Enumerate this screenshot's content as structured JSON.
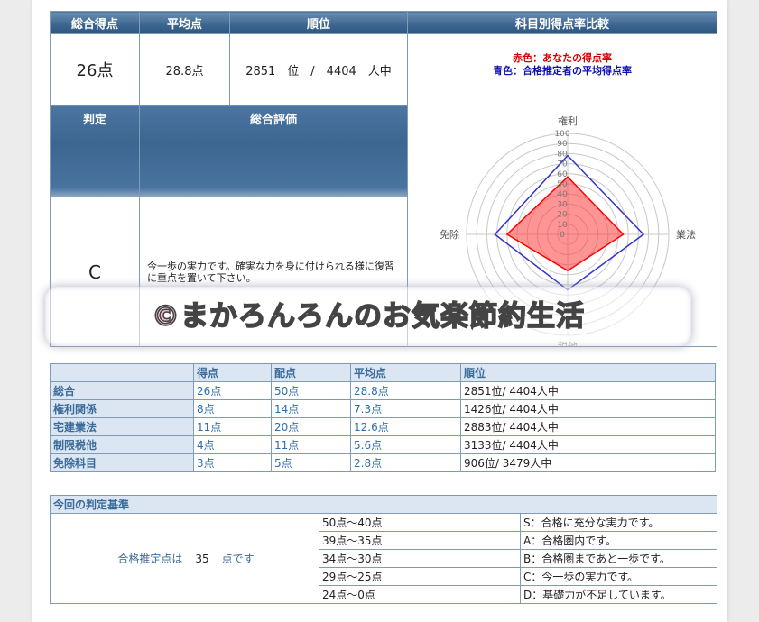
{
  "summary": {
    "headers": {
      "total": "総合得点",
      "average": "平均点",
      "rank": "順位",
      "compare": "科目別得点率比較"
    },
    "total_score": "26点",
    "average_score": "28.8点",
    "rank_text": "2851　位　/　4404　人中",
    "judgement_header": "判定",
    "evaluation_header": "総合評価",
    "judgement": "C",
    "evaluation": "今一歩の実力です。確実な力を身に付けられる様に復習に重点を置いて下さい。"
  },
  "radar": {
    "legend_red": "赤色：あなたの得点率",
    "legend_blue": "青色：合格推定者の平均得点率",
    "axes": [
      "権利",
      "業法",
      "税他",
      "免除"
    ],
    "ticks": [
      "100",
      "90",
      "80",
      "70",
      "60",
      "50",
      "40",
      "30",
      "20",
      "10",
      "0"
    ],
    "colors": {
      "you": "#ff0000",
      "passers": "#3333cc"
    }
  },
  "chart_data": {
    "type": "radar",
    "categories": [
      "権利",
      "業法",
      "税他",
      "免除"
    ],
    "range": [
      0,
      100
    ],
    "series": [
      {
        "name": "あなたの得点率",
        "values": [
          57,
          55,
          36,
          60
        ]
      },
      {
        "name": "合格推定者の平均得点率",
        "values": [
          78,
          75,
          55,
          72
        ]
      }
    ]
  },
  "watermark": "©まかろんろんのお気楽節約生活",
  "scores": {
    "columns": [
      "",
      "得点",
      "配点",
      "平均点",
      "順位"
    ],
    "rows": [
      {
        "label": "総合",
        "score": "26点",
        "max": "50点",
        "avg": "28.8点",
        "rank": "2851位/ 4404人中"
      },
      {
        "label": "権利関係",
        "score": "8点",
        "max": "14点",
        "avg": "7.3点",
        "rank": "1426位/ 4404人中"
      },
      {
        "label": "宅建業法",
        "score": "11点",
        "max": "20点",
        "avg": "12.6点",
        "rank": "2883位/ 4404人中"
      },
      {
        "label": "制限税他",
        "score": "4点",
        "max": "11点",
        "avg": "5.6点",
        "rank": "3133位/ 4404人中"
      },
      {
        "label": "免除科目",
        "score": "3点",
        "max": "5点",
        "avg": "2.8点",
        "rank": "906位/ 3479人中"
      }
    ]
  },
  "criteria": {
    "title": "今回の判定基準",
    "pass_text_before": "合格推定点は",
    "pass_score": "35",
    "pass_text_after": "点です",
    "rows": [
      {
        "range": "50点〜40点",
        "desc": "S：合格に充分な実力です。"
      },
      {
        "range": "39点〜35点",
        "desc": "A：合格圏内です。"
      },
      {
        "range": "34点〜30点",
        "desc": "B：合格圏まであと一歩です。"
      },
      {
        "range": "29点〜25点",
        "desc": "C：今一歩の実力です。"
      },
      {
        "range": "24点〜0点",
        "desc": "D：基礎力が不足しています。"
      }
    ]
  }
}
